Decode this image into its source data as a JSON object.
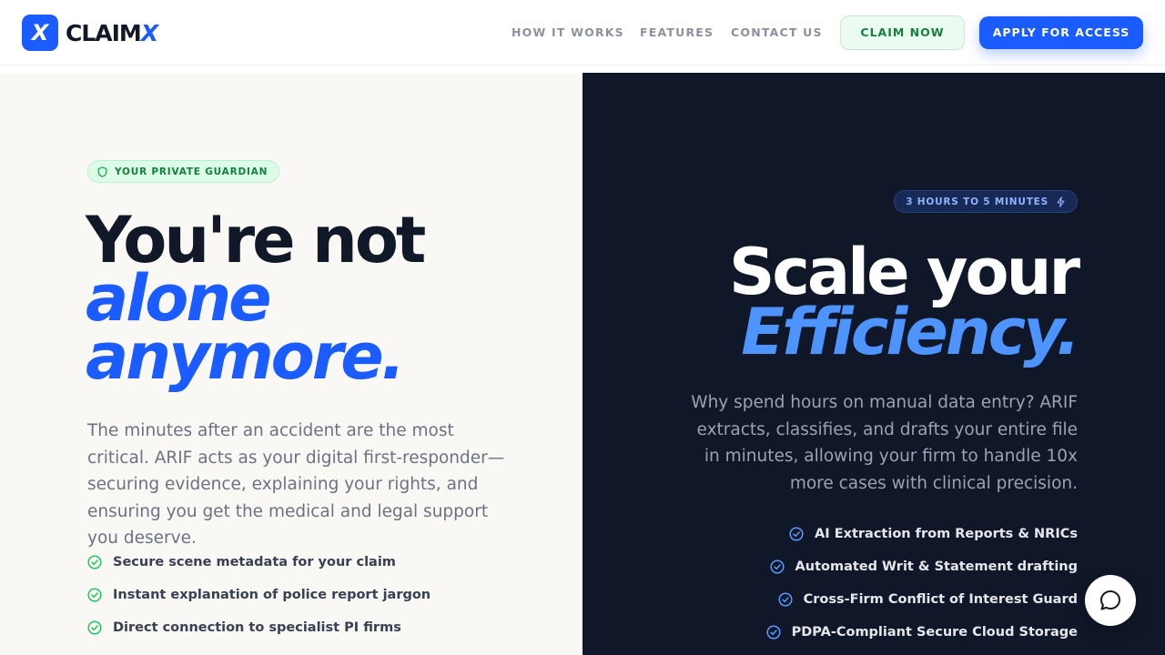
{
  "header": {
    "logo_mark": "X",
    "logo_text": "CLAIM",
    "logo_accent": "X",
    "nav": [
      "HOW IT WORKS",
      "FEATURES",
      "CONTACT US"
    ],
    "claim_button": "CLAIM NOW",
    "apply_button": "APPLY FOR ACCESS"
  },
  "left": {
    "badge": "YOUR PRIVATE GUARDIAN",
    "headline_line1": "You're not",
    "headline_line2": "alone",
    "headline_line3": "anymore.",
    "paragraph": "The minutes after an accident are the most critical. ARIF acts as your digital first-responder—securing evidence, explaining your rights, and ensuring you get the medical and legal support you deserve.",
    "features": [
      "Secure scene metadata for your claim",
      "Instant explanation of police report jargon",
      "Direct connection to specialist PI firms"
    ]
  },
  "right": {
    "badge": "3 HOURS TO 5 MINUTES",
    "headline_line1": "Scale your",
    "headline_line2": "Efficiency.",
    "paragraph": "Why spend hours on manual data entry? ARIF extracts, classifies, and drafts your entire file in minutes, allowing your firm to handle 10x more cases with clinical precision.",
    "features": [
      "AI Extraction from Reports & NRICs",
      "Automated Writ & Statement drafting",
      "Cross-Firm Conflict of Interest Guard",
      "PDPA-Compliant Secure Cloud Storage"
    ]
  },
  "icons": {
    "logo": "logo-x-icon",
    "badge_left": "shield-icon",
    "badge_right": "lightning-bolt-icon",
    "list_item": "check-circle-icon",
    "chat": "chat-bubble-icon"
  },
  "colors": {
    "brand_blue": "#1a5cff",
    "accent_green": "#15803d",
    "dark_panel": "#0f1729",
    "light_panel": "#f9f8f5",
    "highlight_blue_dark": "#4d94ff"
  }
}
